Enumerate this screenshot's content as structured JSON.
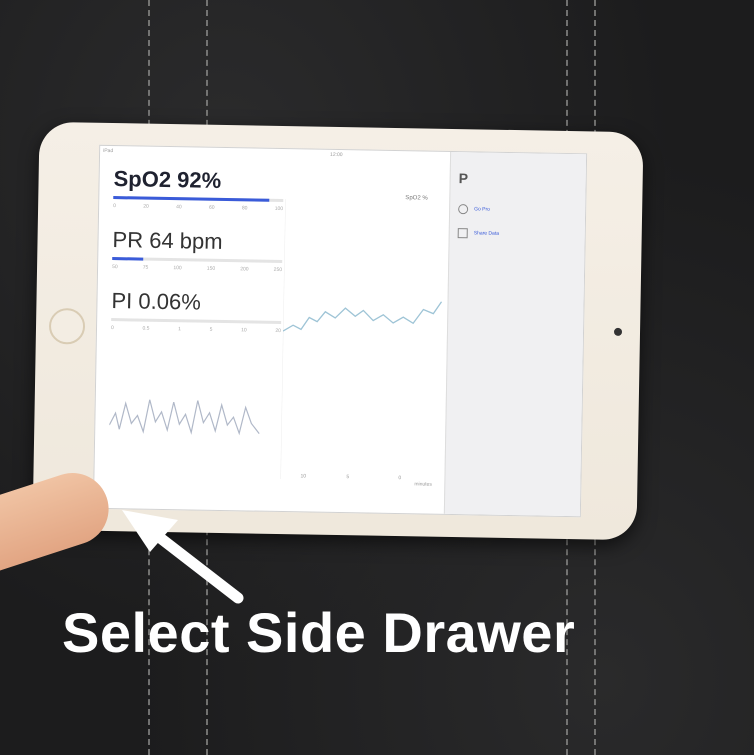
{
  "caption": "Select Side Drawer",
  "app": {
    "spo2": {
      "label": "SpO2 92%",
      "level_pct": 92,
      "ticks": [
        "0",
        "20",
        "40",
        "60",
        "80",
        "100"
      ]
    },
    "pr": {
      "label": "PR 64 bpm",
      "level_pct": 18,
      "ticks": [
        "50",
        "75",
        "100",
        "150",
        "200",
        "250"
      ]
    },
    "pi": {
      "label": "PI 0.06%",
      "ticks": [
        "0",
        "0.5",
        "1",
        "5",
        "10",
        "20"
      ]
    },
    "chart": {
      "series_label": "SpO2 %",
      "xlabel": "minutes",
      "x_ticks": [
        "10",
        "5",
        "0"
      ]
    },
    "drawer": {
      "title": "P",
      "items": [
        {
          "label": "Go Pro",
          "icon": "gift-icon"
        },
        {
          "label": "Share Data",
          "icon": "share-icon"
        }
      ]
    }
  },
  "colors": {
    "accent": "#3a5bd9",
    "caption": "#ffffff"
  }
}
